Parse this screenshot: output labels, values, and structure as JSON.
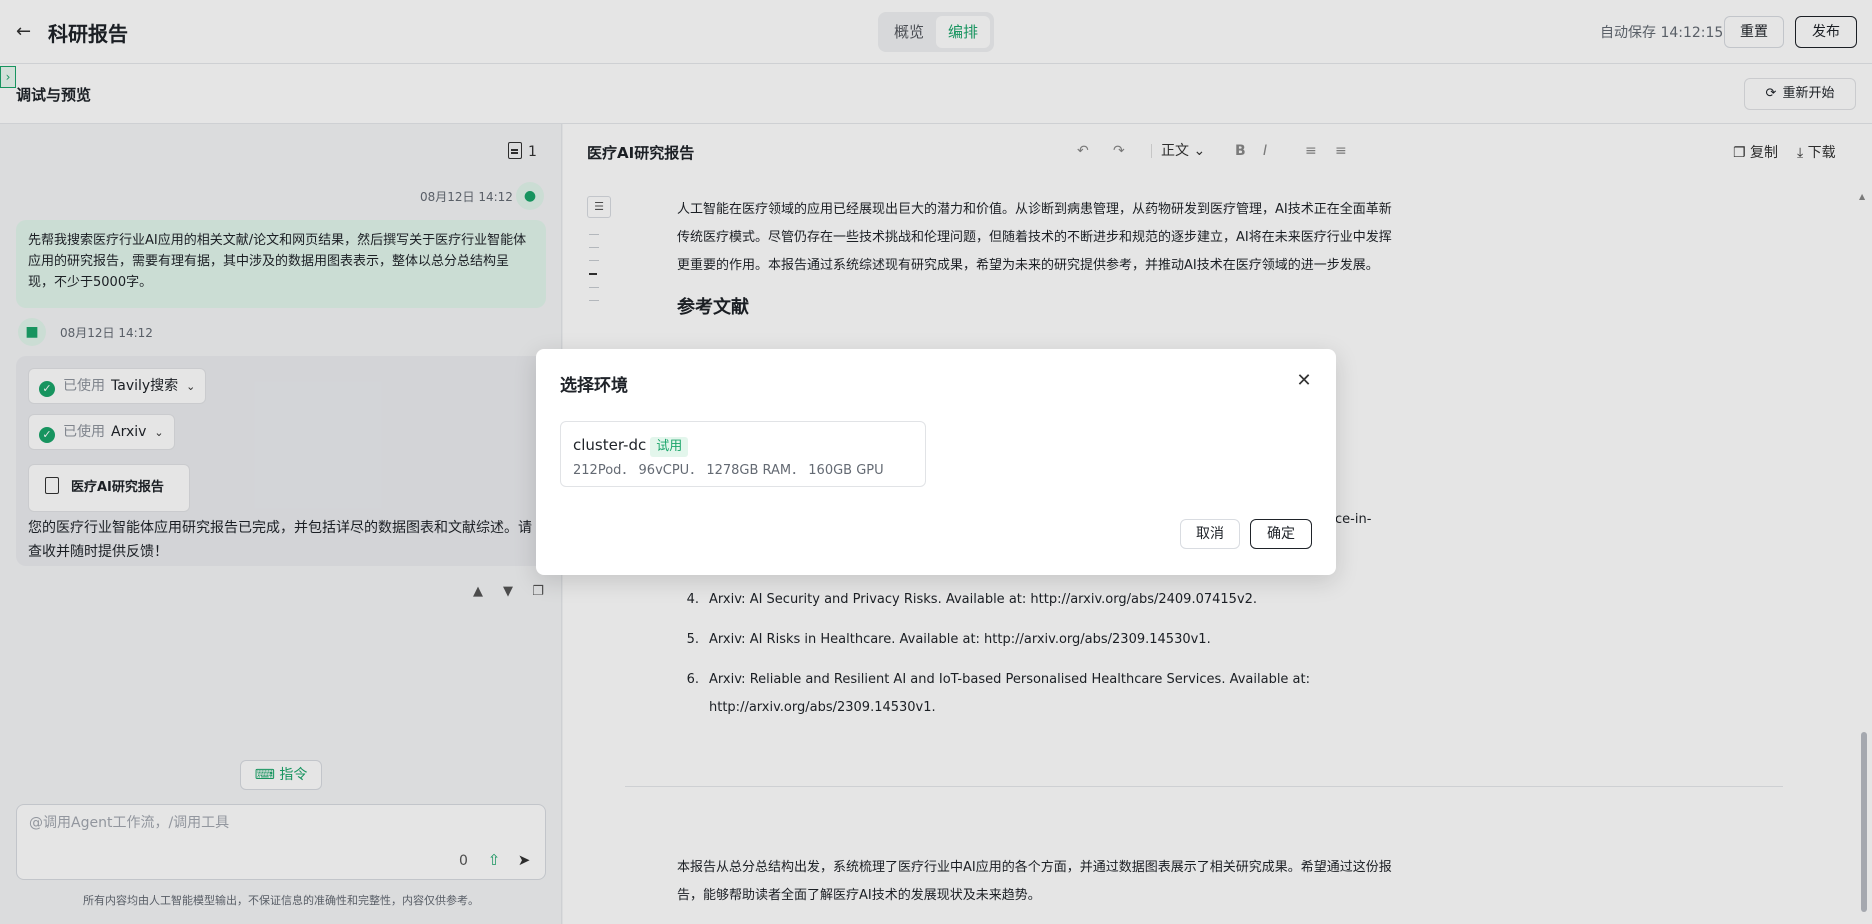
{
  "header": {
    "back_icon": "arrow-left-icon",
    "title": "科研报告",
    "tabs": [
      {
        "label": "概览",
        "active": false
      },
      {
        "label": "编排",
        "active": true
      }
    ],
    "autosave": "自动保存 14:12:15",
    "reset_label": "重置",
    "publish_label": "发布"
  },
  "section": {
    "title": "调试与预览",
    "restart_label": "重新开始"
  },
  "chat": {
    "doc_count": "1",
    "user_time": "08月12日 14:12",
    "user_message": "先帮我搜索医疗行业AI应用的相关文献/论文和网页结果，然后撰写关于医疗行业智能体应用的研究报告，需要有理有据，其中涉及的数据用图表表示，整体以总分总结构呈现，不少于5000字。",
    "bot_time": "08月12日 14:12",
    "tools": [
      {
        "used_label": "已使用",
        "name": "Tavily搜索"
      },
      {
        "used_label": "已使用",
        "name": "Arxiv"
      }
    ],
    "report_card_label": "医疗AI研究报告",
    "bot_reply": "您的医疗行业智能体应用研究报告已完成，并包括详尽的数据图表和文献综述。请查收并随时提供反馈！",
    "command_label": "指令",
    "input_placeholder": "@调用Agent工作流，/调用工具",
    "char_count": "0",
    "disclaimer": "所有内容均由人工智能模型输出，不保证信息的准确性和完整性，内容仅供参考。"
  },
  "editor": {
    "doc_title": "医疗AI研究报告",
    "style_label": "正文",
    "copy_label": "复制",
    "download_label": "下载",
    "intro_paragraph": "人工智能在医疗领域的应用已经展现出巨大的潜力和价值。从诊断到病患管理，从药物研发到医疗管理，AI技术正在全面革新传统医疗模式。尽管仍存在一些技术挑战和伦理问题，但随着技术的不断进步和规范的逐步建立，AI将在未来医疗行业中发挥更重要的作用。本报告通过系统综述现有研究成果，希望为未来的研究提供参考，并推动AI技术在医疗领域的进一步发展。",
    "references_heading": "参考文献",
    "partial_text": "ce-in-",
    "references": [
      {
        "num": "4.",
        "text": "Arxiv: AI Security and Privacy Risks. Available at: http://arxiv.org/abs/2409.07415v2."
      },
      {
        "num": "5.",
        "text": "Arxiv: AI Risks in Healthcare. Available at: http://arxiv.org/abs/2309.14530v1."
      },
      {
        "num": "6.",
        "text": "Arxiv: Reliable and Resilient AI and IoT-based Personalised Healthcare Services. Available at: http://arxiv.org/abs/2309.14530v1."
      }
    ],
    "conclusion": "本报告从总分总结构出发，系统梳理了医疗行业中AI应用的各个方面，并通过数据图表展示了相关研究成果。希望通过这份报告，能够帮助读者全面了解医疗AI技术的发展现状及未来趋势。"
  },
  "modal": {
    "title": "选择环境",
    "env": {
      "name": "cluster-dc",
      "badge": "试用",
      "specs": "212Pod． 96vCPU． 1278GB RAM． 160GB GPU"
    },
    "cancel_label": "取消",
    "confirm_label": "确定"
  },
  "colors": {
    "accent": "#1aa56a",
    "accent_bg": "#e3f6ec"
  }
}
